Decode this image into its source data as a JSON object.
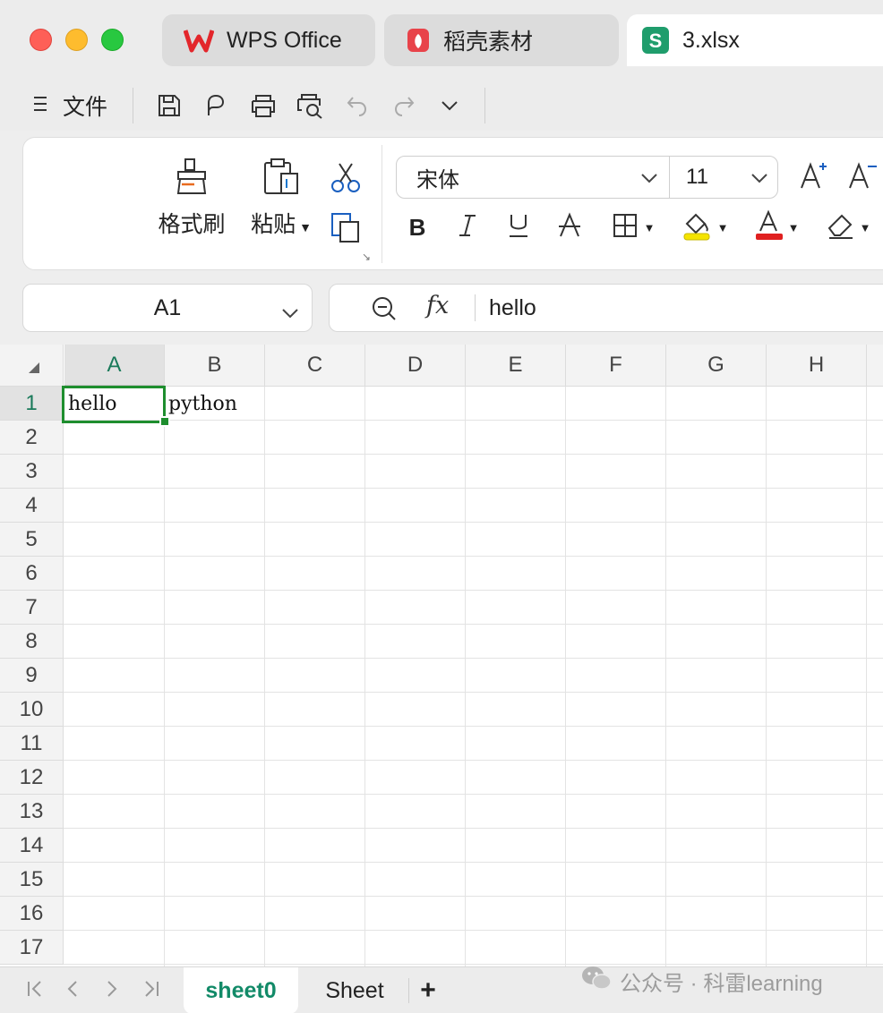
{
  "titlebar": {
    "tabs": [
      {
        "label": "WPS Office",
        "icon": "wps-logo-icon"
      },
      {
        "label": "稻壳素材",
        "icon": "docer-logo-icon"
      },
      {
        "label": "3.xlsx",
        "icon": "spreadsheet-logo-icon"
      }
    ],
    "active_tab_index": 2
  },
  "quickbar": {
    "menu_label": "文件",
    "icons": [
      "save-icon",
      "export-pdf-icon",
      "print-icon",
      "print-preview-icon",
      "undo-icon",
      "redo-icon",
      "more-chevron-icon"
    ]
  },
  "ribbon": {
    "format_painter_label": "格式刷",
    "paste_label": "粘贴",
    "font_name": "宋体",
    "font_size": "11",
    "colors": {
      "highlight": "#f5e400",
      "font_color": "#e02020"
    }
  },
  "formula": {
    "cell_ref": "A1",
    "fx_label": "fx",
    "value": "hello"
  },
  "grid": {
    "columns": [
      "A",
      "B",
      "C",
      "D",
      "E",
      "F",
      "G",
      "H"
    ],
    "rows": [
      "1",
      "2",
      "3",
      "4",
      "5",
      "6",
      "7",
      "8",
      "9",
      "10",
      "11",
      "12",
      "13",
      "14",
      "15",
      "16",
      "17"
    ],
    "cells": {
      "A1": "hello",
      "B1": "python"
    },
    "selected_cell": "A1",
    "selection_color": "#1e8e2e"
  },
  "sheets": {
    "tabs": [
      "sheet0",
      "Sheet"
    ],
    "active_index": 0,
    "add_label": "+"
  },
  "watermark": {
    "text": "公众号 · 科雷learning"
  }
}
